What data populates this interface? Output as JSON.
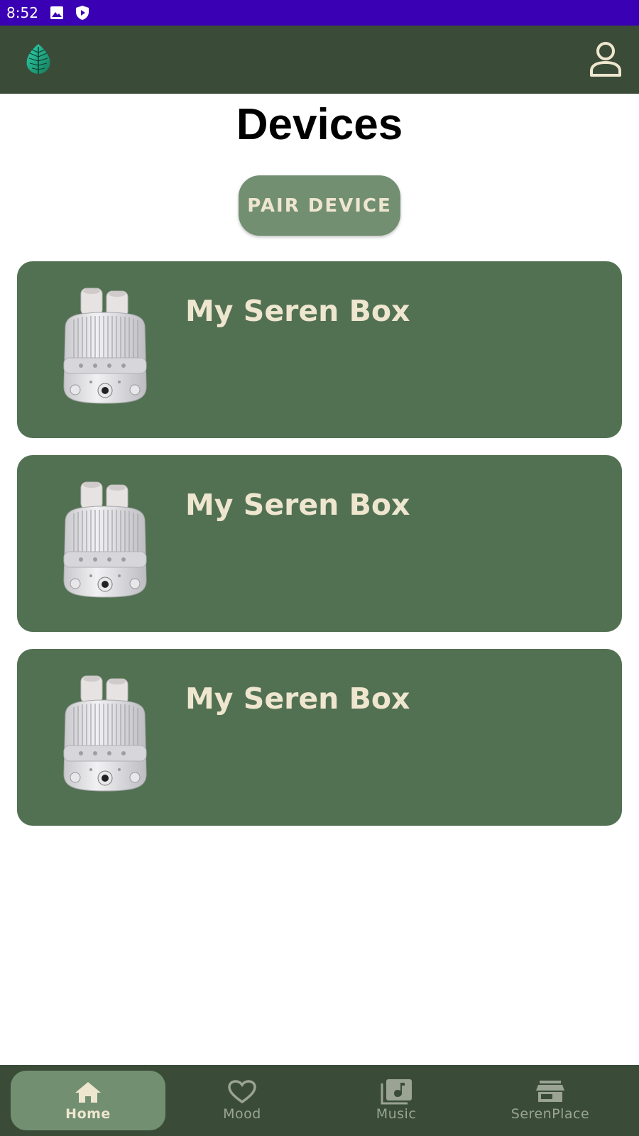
{
  "status_bar": {
    "time": "8:52",
    "icons": [
      "image-icon",
      "shield-play-icon"
    ]
  },
  "app_bar": {
    "logo_icon": "leaf-logo-icon",
    "profile_icon": "user-profile-icon"
  },
  "page": {
    "title": "Devices",
    "pair_button_label": "PAIR DEVICE"
  },
  "devices": [
    {
      "name": "My Seren Box",
      "image": "seren-box-device-image"
    },
    {
      "name": "My Seren Box",
      "image": "seren-box-device-image"
    },
    {
      "name": "My Seren Box",
      "image": "seren-box-device-image"
    }
  ],
  "bottom_nav": {
    "items": [
      {
        "label": "Home",
        "icon": "home-icon",
        "active": true
      },
      {
        "label": "Mood",
        "icon": "heart-icon",
        "active": false
      },
      {
        "label": "Music",
        "icon": "music-library-icon",
        "active": false
      },
      {
        "label": "SerenPlace",
        "icon": "store-icon",
        "active": false
      }
    ]
  },
  "colors": {
    "status_bar": "#3a00b3",
    "app_bar": "#3a4c38",
    "card": "#527152",
    "button": "#728f71",
    "accent_text": "#efe6cf",
    "nav_inactive": "#9aa394"
  }
}
